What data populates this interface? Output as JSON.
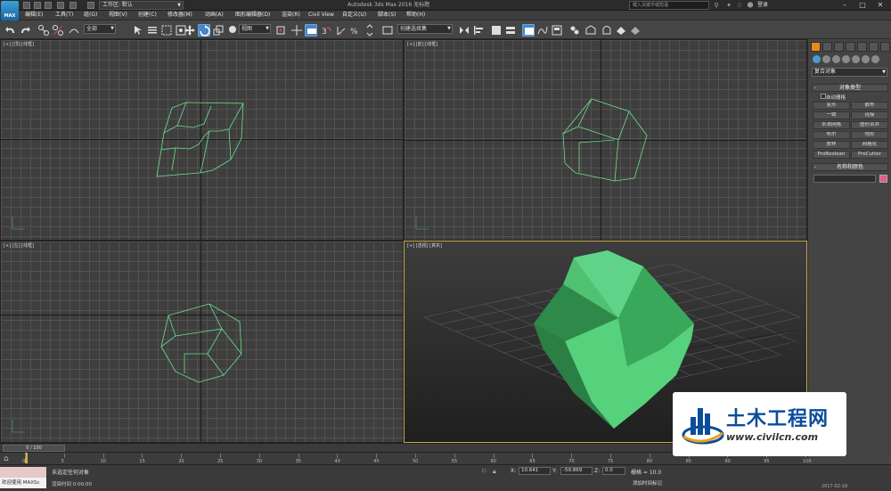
{
  "titlebar": {
    "logo_text": "MAX",
    "workspace_label": "工作区: 默认",
    "app_title": "Autodesk 3ds Max 2016    无标题",
    "search_placeholder": "键入关键字或短语",
    "login_label": "登录"
  },
  "menubar": {
    "items": [
      "编辑(E)",
      "工具(T)",
      "组(G)",
      "视图(V)",
      "创建(C)",
      "修改器(M)",
      "动画(A)",
      "图形编辑器(D)",
      "渲染(R)",
      "Civil View",
      "自定义(U)",
      "脚本(S)",
      "帮助(H)"
    ]
  },
  "toolbar": {
    "filter_value": "全部",
    "coord_value": "视图",
    "selection_set_placeholder": "创建选择集"
  },
  "viewports": {
    "top": "[+] [顶] [线框]",
    "front": "[+] [前] [线框]",
    "left": "[+] [左] [线框]",
    "perspective": "[+] [透视] [真实]"
  },
  "cmdpanel": {
    "dropdown_value": "复合对象",
    "object_type_header": "对象类型",
    "autogrid_label": "自动栅格",
    "buttons": [
      "变形",
      "散布",
      "一致",
      "连接",
      "水滴网格",
      "图形合并",
      "布尔",
      "地形",
      "放样",
      "网格化",
      "ProBoolean",
      "ProCutter"
    ],
    "name_color_header": "名称和颜色",
    "color_hex": "#e85a8a"
  },
  "timeline": {
    "frame_label": "0 / 100",
    "ticks": [
      "0",
      "5",
      "10",
      "15",
      "20",
      "25",
      "30",
      "35",
      "40",
      "45",
      "50",
      "55",
      "60",
      "65",
      "70",
      "75",
      "80",
      "85",
      "90",
      "95",
      "100"
    ]
  },
  "status": {
    "maxscript_label": "欢迎使用 MAXSc",
    "selection_text": "未选定任何对象",
    "render_time": "渲染时间  0:00:00",
    "x_label": "X:",
    "x_value": "10.641",
    "y_label": "Y:",
    "y_value": "-59.869",
    "z_label": "Z:",
    "z_value": "0.0",
    "grid_text": "栅格 = 10.0",
    "add_time_tag": "添加时间标记",
    "date": "2017-02-18"
  },
  "watermark": {
    "title": "土木工程网",
    "url": "www.civilcn.com"
  }
}
